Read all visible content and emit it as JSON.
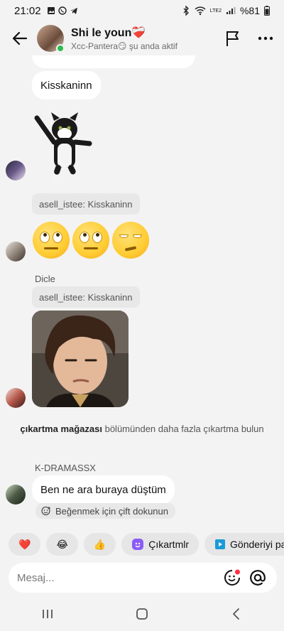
{
  "status": {
    "time": "21:02",
    "battery": "%81",
    "network": "LTE2"
  },
  "header": {
    "title": "Shi le youn",
    "subtitle": "Xcc-Pantera😏 şu anda aktif",
    "title_heart": "❤️‍🩹"
  },
  "messages": {
    "m1_text": "Kisskaninn",
    "reply1": "asell_istee: Kisskaninn",
    "emojis": [
      "🙄",
      "🙄",
      "😒"
    ],
    "dicle_sender": "Dicle",
    "reply2": "asell_istee: Kisskaninn",
    "info_bold": "çıkartma mağazası",
    "info_rest": " bölümünden daha fazla çıkartma bulun",
    "kdrama_sender": "K-DRAMASSX",
    "m2_text": "Ben ne ara buraya düştüm",
    "like_hint": "Beğenmek için çift dokunun"
  },
  "quick_reactions": {
    "heart": "❤️",
    "laugh": "😂",
    "thumbs": "👍",
    "stickers": "Çıkartmlr",
    "send_post": "Gönderiyi pa"
  },
  "composer": {
    "placeholder": "Mesaj..."
  },
  "colors": {
    "background": "#f3f3f3",
    "bubble": "#ffffff",
    "online": "#2dbd4e",
    "accent_purple": "#8a5cf5",
    "accent_blue": "#1a9ad6",
    "notification_red": "#ff3040"
  }
}
